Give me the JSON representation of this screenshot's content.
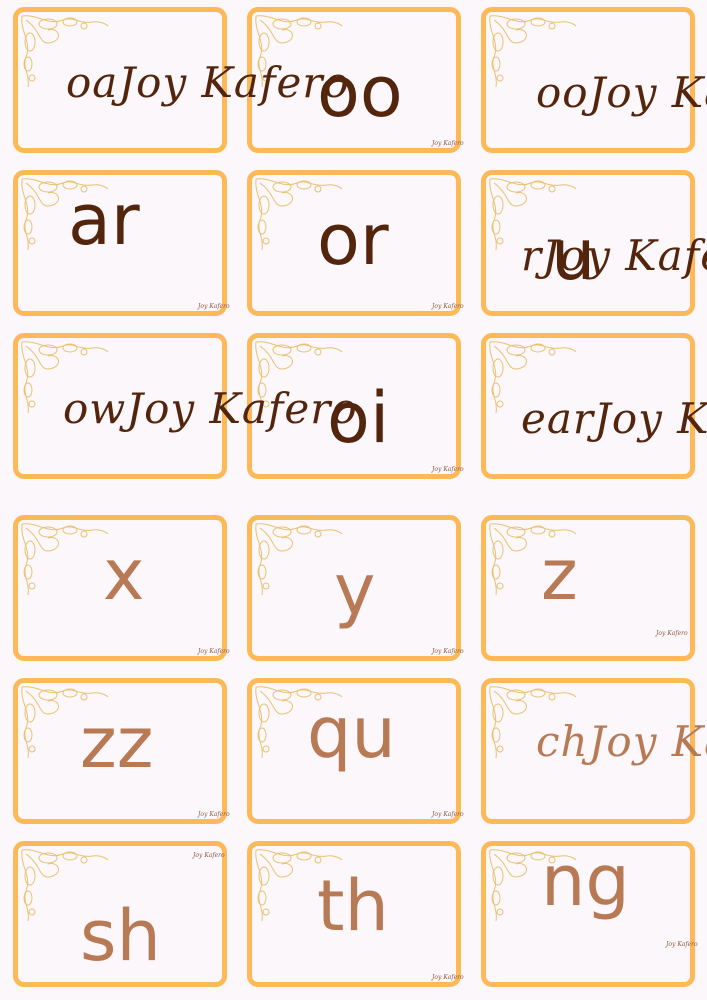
{
  "colors": {
    "border": "#fdb957",
    "dark_text": "#54250d",
    "light_text": "#b87a55",
    "background": "#fcf7fb"
  },
  "signature": "Joy Kafero",
  "cards": [
    {
      "text": "oa",
      "style": "script"
    },
    {
      "text": "oo",
      "style": "sans"
    },
    {
      "text": "oo",
      "style": "script"
    },
    {
      "text": "ar",
      "style": "sans"
    },
    {
      "text": "or",
      "style": "sans"
    },
    {
      "text": "u",
      "script_text": "r",
      "style": "mixed"
    },
    {
      "text": "ow",
      "style": "script"
    },
    {
      "text": "oi",
      "style": "sans"
    },
    {
      "text": "ear",
      "style": "script"
    },
    {
      "text": "x",
      "style": "sans"
    },
    {
      "text": "y",
      "style": "sans"
    },
    {
      "text": "z",
      "style": "sans"
    },
    {
      "text": "zz",
      "style": "sans"
    },
    {
      "text": "qu",
      "style": "sans"
    },
    {
      "text": "ch",
      "style": "script"
    },
    {
      "text": "sh",
      "style": "sans"
    },
    {
      "text": "th",
      "style": "sans"
    },
    {
      "text": "ng",
      "style": "sans"
    }
  ]
}
